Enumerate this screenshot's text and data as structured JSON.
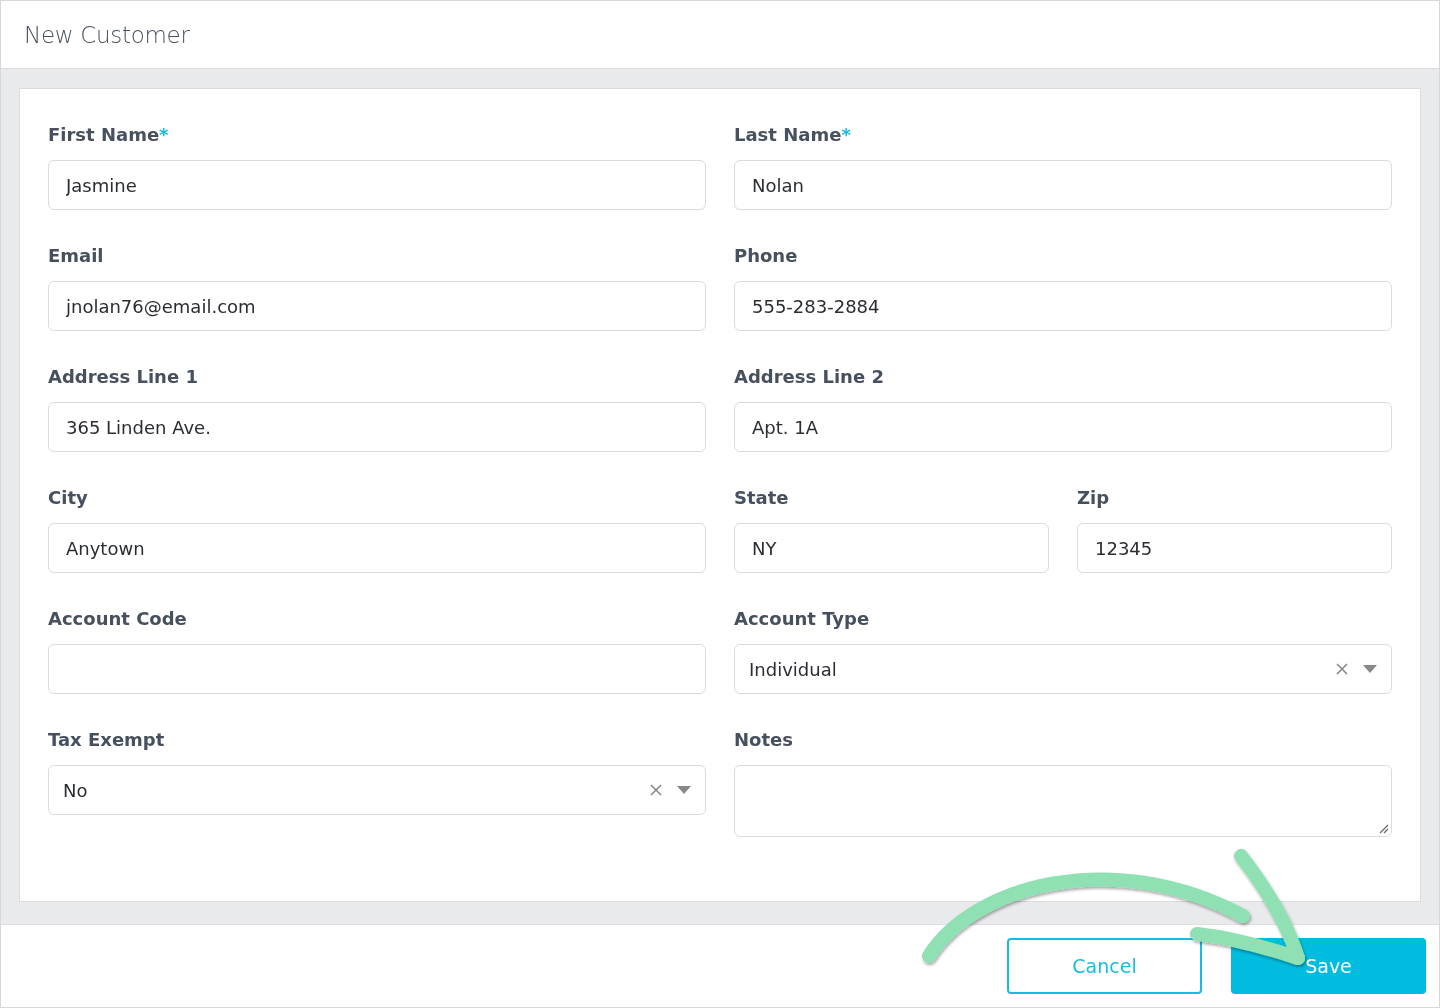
{
  "window": {
    "title": "New Customer"
  },
  "rows": [
    {
      "cells": [
        {
          "kind": "text",
          "label": "First Name",
          "required_mark": "*",
          "value": "Jasmine"
        },
        {
          "kind": "text",
          "label": "Last Name",
          "required_mark": "*",
          "value": "Nolan"
        }
      ]
    },
    {
      "cells": [
        {
          "kind": "text",
          "label": "Email",
          "value": "jnolan76@email.com"
        },
        {
          "kind": "text",
          "label": "Phone",
          "value": "555-283-2884"
        }
      ]
    },
    {
      "cells": [
        {
          "kind": "text",
          "label": "Address Line 1",
          "value": "365 Linden Ave."
        },
        {
          "kind": "text",
          "label": "Address Line 2",
          "value": "Apt. 1A"
        }
      ]
    },
    {
      "cells": [
        {
          "kind": "text",
          "label": "City",
          "value": "Anytown"
        },
        {
          "kind": "group",
          "fields": [
            {
              "kind": "text",
              "label": "State",
              "value": "NY"
            },
            {
              "kind": "text",
              "label": "Zip",
              "value": "12345"
            }
          ]
        }
      ]
    },
    {
      "cells": [
        {
          "kind": "text",
          "label": "Account Code"
        },
        {
          "kind": "select",
          "label": "Account Type",
          "value": "Individual"
        }
      ]
    },
    {
      "cells": [
        {
          "kind": "select",
          "label": "Tax Exempt",
          "value": "No"
        },
        {
          "kind": "textarea",
          "label": "Notes"
        }
      ]
    }
  ],
  "buttons": [
    {
      "kind": "secondary",
      "label": "Cancel"
    },
    {
      "kind": "primary",
      "label": "Save"
    }
  ]
}
